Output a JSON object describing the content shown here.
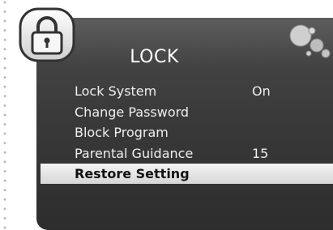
{
  "screen": {
    "title": "LOCK"
  },
  "menu": {
    "items": [
      {
        "label": "Lock System",
        "value": "On"
      },
      {
        "label": "Change Password",
        "value": ""
      },
      {
        "label": "Block Program",
        "value": ""
      },
      {
        "label": "Parental Guidance",
        "value": "15"
      },
      {
        "label": "Restore Setting",
        "value": "",
        "selected": true
      }
    ]
  },
  "icons": {
    "badge": "lock-icon",
    "decoration": "bubbles-icon"
  },
  "colors": {
    "panel": "#3a3a3a",
    "highlight": "#e6e6e6",
    "text": "#eeeeee"
  }
}
